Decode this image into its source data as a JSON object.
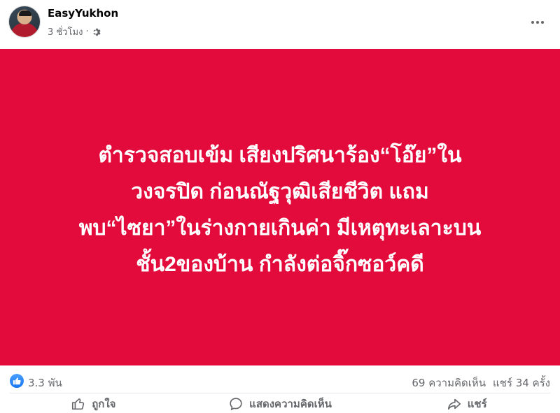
{
  "post": {
    "author": "EasyYukhon",
    "time": "3 ชั่วโมง",
    "separator": "·",
    "privacy_icon": "gear-icon",
    "more_icon": "more-dots-icon"
  },
  "card": {
    "background": "#e20b3b",
    "text": "ตำรวจสอบเข้ม เสียงปริศนาร้อง“โอ๊ย”ใน\nวงจรปิด ก่อนณัฐวุฒิเสียชีวิต แถม\nพบ“ไซยา”ในร่างกายเกินค่า มีเหตุทะเลาะบน\nชั้น2ของบ้าน กำลังต่อจิ๊กซอว์คดี"
  },
  "stats": {
    "reactions": "3.3 พัน",
    "comments": "69 ความคิดเห็น",
    "shares": "แชร์ 34 ครั้ง"
  },
  "actions": {
    "like": "ถูกใจ",
    "comment": "แสดงความคิดเห็น",
    "share": "แชร์"
  }
}
